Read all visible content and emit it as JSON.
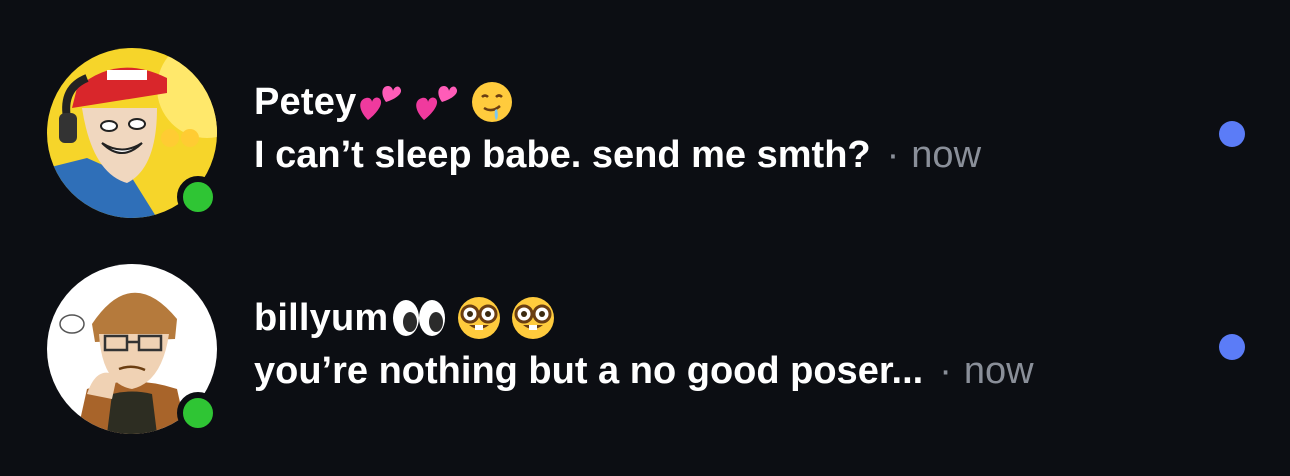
{
  "conversations": [
    {
      "name": "Petey",
      "name_emojis": [
        "two-hearts",
        "two-hearts",
        "drooling-face"
      ],
      "message": "I can’t sleep babe. send me smth?",
      "separator": "·",
      "time": "now",
      "online": true,
      "unread": true
    },
    {
      "name": "billyum",
      "name_emojis": [
        "eyes",
        "nerd-face",
        "nerd-face"
      ],
      "message": "you’re nothing but a no good poser...",
      "separator": "·",
      "time": "now",
      "online": true,
      "unread": true
    }
  ],
  "colors": {
    "background": "#0c0e13",
    "online": "#2fc534",
    "unread": "#5b7cf7",
    "secondary_text": "#8a8f99"
  }
}
